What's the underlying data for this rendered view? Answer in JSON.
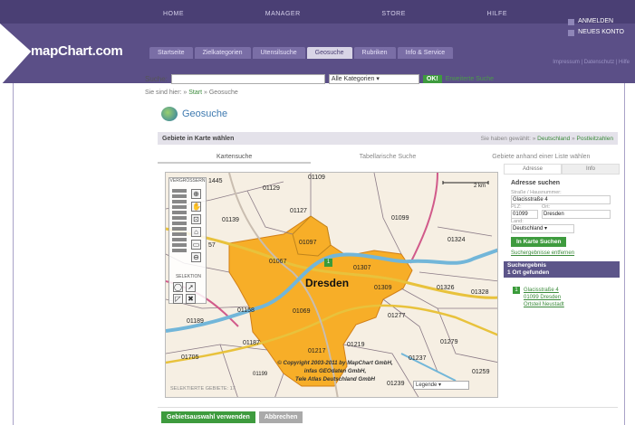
{
  "header": {
    "logo": "mapChart.com",
    "topnav": [
      "HOME",
      "MANAGER",
      "STORE",
      "HILFE"
    ],
    "account": [
      "ANMELDEN",
      "NEUES KONTO"
    ],
    "tabs": [
      "Startseite",
      "Zielkategorien",
      "Utensilsuche",
      "Geosuche",
      "Rubriken",
      "Info & Service"
    ],
    "active_tab": "Geosuche",
    "util_links": "Impressum | Datenschutz | Hilfe"
  },
  "search": {
    "label": "Suche:",
    "value": "",
    "category": "Alle Kategorien",
    "ok": "OK!",
    "erweitert": "Erweiterte Suche"
  },
  "breadcrumb": {
    "prefix": "Sie sind hier:",
    "home": "Start",
    "current": "Geosuche"
  },
  "page": {
    "title": "Geosuche",
    "subheader": "Gebiete in Karte wählen",
    "subheader_right": "Sie haben gewählt: » Deutschland » Postleitzahlen",
    "subheader_links": [
      "Deutschland",
      "Postleitzahlen"
    ]
  },
  "subtabs": [
    "Kartensuche",
    "Tabellarische Suche",
    "Gebiete anhand einer Liste wählen"
  ],
  "map": {
    "city": "Dresden",
    "marker": "1",
    "scale": "2 km",
    "toolbar_top_label": "VERGRÖSSERN",
    "toolbar_bottom_label": "SELEKTION",
    "postcodes": [
      {
        "code": "1445"
      },
      {
        "code": "01129"
      },
      {
        "code": "01109"
      },
      {
        "code": "01139"
      },
      {
        "code": "01127"
      },
      {
        "code": "01099"
      },
      {
        "code": "01097"
      },
      {
        "code": "01324"
      },
      {
        "code": "57"
      },
      {
        "code": "01067"
      },
      {
        "code": "01307"
      },
      {
        "code": "01309"
      },
      {
        "code": "01326"
      },
      {
        "code": "01328"
      },
      {
        "code": "01158"
      },
      {
        "code": "01069"
      },
      {
        "code": "01277"
      },
      {
        "code": "01189"
      },
      {
        "code": "01187"
      },
      {
        "code": "01217"
      },
      {
        "code": "01219"
      },
      {
        "code": "01279"
      },
      {
        "code": "01705"
      },
      {
        "code": "01237"
      },
      {
        "code": "01259"
      },
      {
        "code": "01239"
      },
      {
        "code": "01199"
      }
    ],
    "copyright": [
      "© Copyright 2003-2011 by MapChart GmbH,",
      "infas GEOdaten GmbH,",
      "Tele Atlas Deutschland GmbH"
    ],
    "footer_left": "SELEKTIERTE GEBIETE: 17",
    "legend": "Legende"
  },
  "panel": {
    "tabs": [
      "Adresse",
      "Info"
    ],
    "title": "Adresse suchen",
    "street_label": "Straße / Hausnummer:",
    "street": "Glacisstraße 4",
    "plz_label": "PLZ:",
    "ort_label": "Ort:",
    "plz": "01099",
    "ort": "Dresden",
    "land_label": "Land:",
    "land": "Deutschland",
    "search_button": "In Karte Suchen",
    "link": "Suchergebnisse entfernen",
    "result_title": "Suchergebnis",
    "result_count": "1 Ort gefunden",
    "result_num": "1",
    "result_lines": [
      "Glacisstraße 4",
      "01099 Dresden",
      "Ortsteil Neustadt"
    ]
  },
  "bottom": {
    "use": "Gebietsauswahl verwenden",
    "reset": "Abbrechen"
  },
  "colors": {
    "brand": "#5b4f87",
    "selected_area": "#f7ae28",
    "water": "#72b6d9",
    "green": "#3e9b3e"
  }
}
